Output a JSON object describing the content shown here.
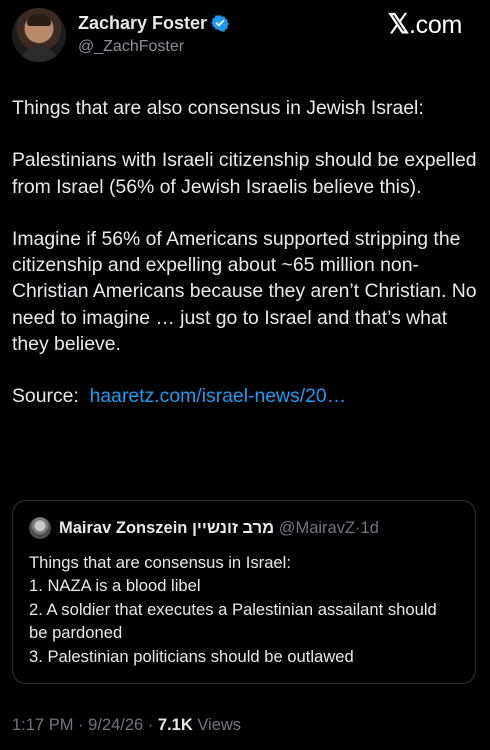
{
  "author": {
    "display_name": "Zachary Foster",
    "handle": "@_ZachFoster"
  },
  "brand": {
    "x_glyph": "𝕏",
    "suffix": ".com"
  },
  "tweet": {
    "line1": "Things that are also consensus in Jewish Israel:",
    "para2": "Palestinians with Israeli citizenship should be expelled from Israel (56% of Jewish Israelis believe this).",
    "para3": "Imagine if 56% of Americans supported stripping the citizenship and expelling about ~65 million non-Christian Americans because they aren’t Christian. No need to imagine … just go to Israel and that’s what they believe.",
    "source_label": "Source:",
    "source_link": "haaretz.com/israel-news/20…"
  },
  "quote": {
    "name": "Mairav Zonszein מרב זונשיין",
    "handle": "@MairavZ",
    "separator": "·",
    "age": "1d",
    "lines": [
      "Things that are consensus in Israel:",
      "1. NAZA is a blood libel",
      "2. A soldier that executes a Palestinian assailant should be pardoned",
      "3. Palestinian politicians should be outlawed"
    ]
  },
  "footer": {
    "time": "1:17 PM",
    "sep1": "·",
    "date": "9/24/26",
    "sep2": "·",
    "views_count": "7.1K",
    "views_label": "Views"
  },
  "colors": {
    "background": "#000000",
    "text": "#e7e9ea",
    "muted": "#71767b",
    "link": "#1d9bf0",
    "verified": "#1d9bf0",
    "border": "#2f3336"
  },
  "icons": {
    "verified": "verified-badge-icon",
    "brand": "x-logo-icon"
  }
}
